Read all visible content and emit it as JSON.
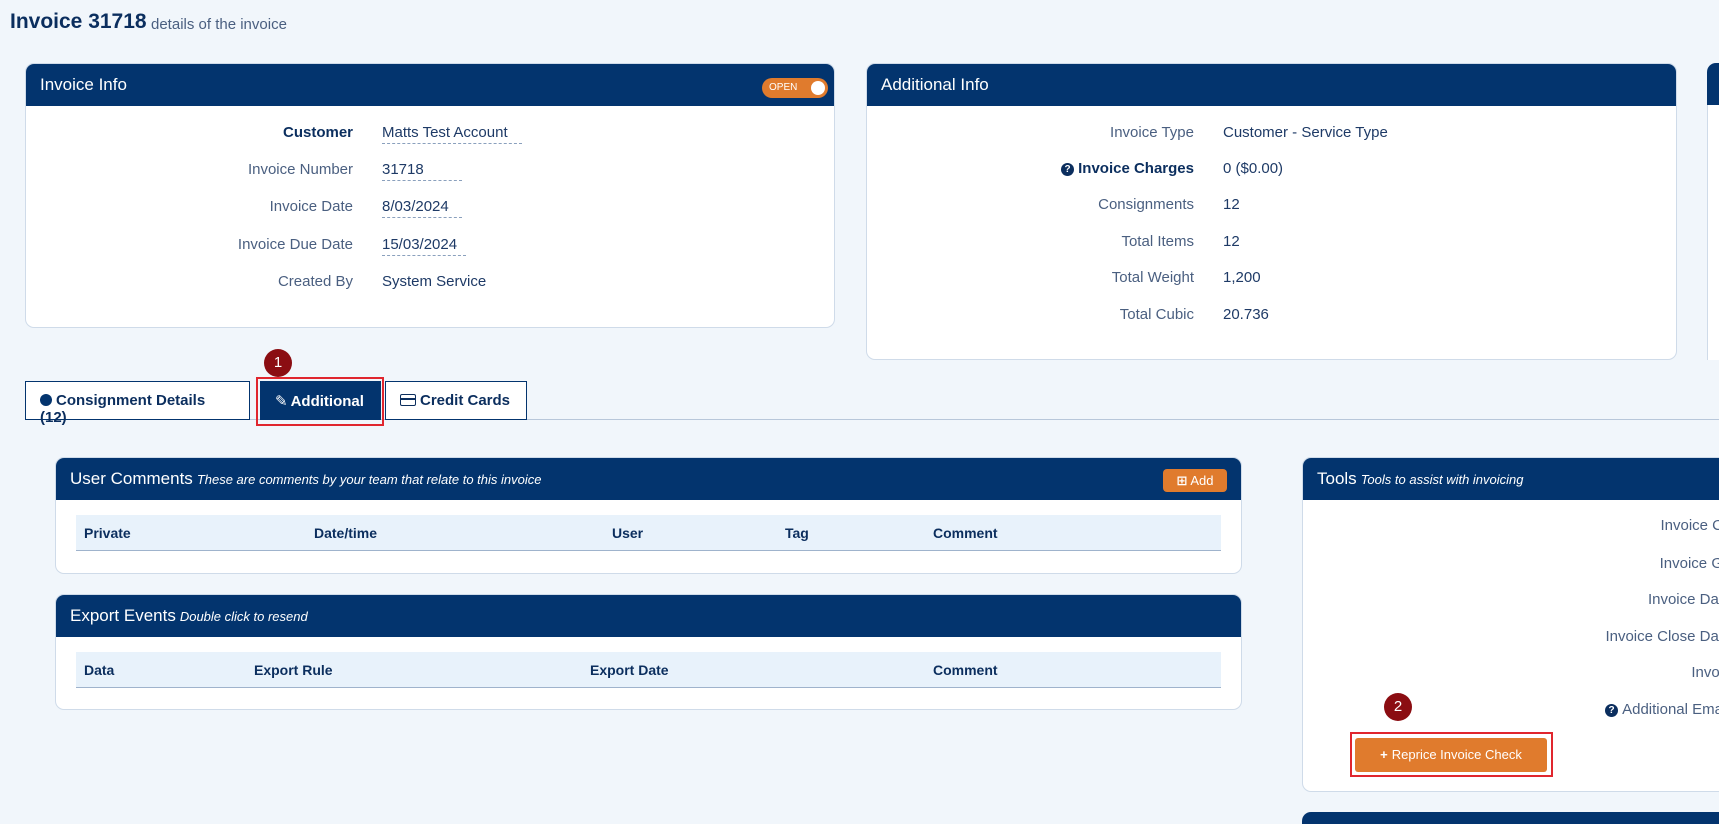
{
  "page": {
    "title": "Invoice 31718",
    "subtitle": "details of the invoice"
  },
  "invoice_info": {
    "title": "Invoice Info",
    "toggle_label": "OPEN",
    "rows": [
      {
        "label": "Customer",
        "value": "Matts Test Account"
      },
      {
        "label": "Invoice Number",
        "value": "31718"
      },
      {
        "label": "Invoice Date",
        "value": "8/03/2024"
      },
      {
        "label": "Invoice Due Date",
        "value": "15/03/2024"
      },
      {
        "label": "Created By",
        "value": "System Service"
      }
    ]
  },
  "additional_info": {
    "title": "Additional Info",
    "rows": [
      {
        "label": "Invoice Type",
        "value": "Customer - Service Type"
      },
      {
        "label": "Invoice Charges",
        "value": "0 ($0.00)"
      },
      {
        "label": "Consignments",
        "value": "12"
      },
      {
        "label": "Total Items",
        "value": "12"
      },
      {
        "label": "Total Weight",
        "value": "1,200"
      },
      {
        "label": "Total Cubic",
        "value": "20.736"
      }
    ]
  },
  "tabs": [
    {
      "label": "Consignment Details (12)"
    },
    {
      "label": "Additional"
    },
    {
      "label": "Credit Cards"
    }
  ],
  "annotations": {
    "badge1": "1",
    "badge2": "2"
  },
  "user_comments": {
    "title": "User Comments",
    "subtitle": "These are comments by your team that relate to this invoice",
    "add_label": "Add",
    "columns": [
      "Private",
      "Date/time",
      "User",
      "Tag",
      "Comment"
    ]
  },
  "export_events": {
    "title": "Export Events",
    "subtitle": "Double click to resend",
    "columns": [
      "Data",
      "Export Rule",
      "Export Date",
      "Comment"
    ]
  },
  "tools": {
    "title": "Tools",
    "subtitle": "Tools to assist with invoicing",
    "rows": [
      "Invoice C",
      "Invoice G",
      "Invoice Dat",
      "Invoice Close Dat",
      "Invoi",
      "Additional Ema"
    ],
    "reprice_label": "Reprice Invoice Check"
  },
  "colors": {
    "navy": "#03346e",
    "accent_orange": "#e07b2d",
    "highlight_red": "#e0262e",
    "badge_red": "#8b0d12"
  }
}
